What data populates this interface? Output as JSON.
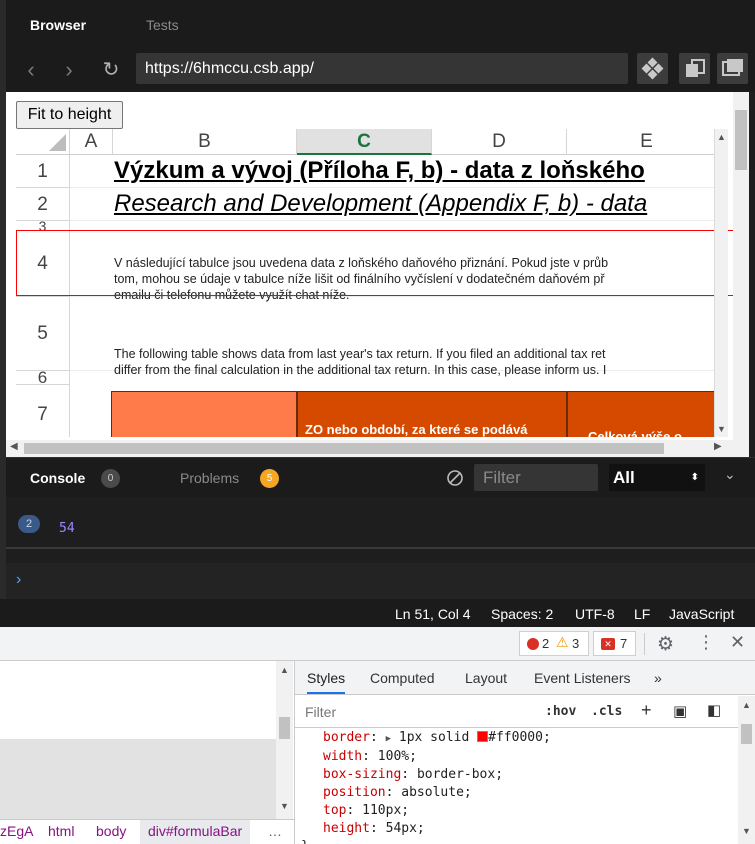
{
  "browser": {
    "tabs": {
      "browser": "Browser",
      "tests": "Tests"
    },
    "url": "https://6hmccu.csb.app/",
    "fit_button": "Fit to height"
  },
  "sheet": {
    "columns": [
      "A",
      "B",
      "C",
      "D",
      "E"
    ],
    "selected_column": "C",
    "rows": [
      "1",
      "2",
      "3",
      "4",
      "5",
      "6",
      "7"
    ],
    "title_cz": "Výzkum a vývoj (Příloha F, b) - data z loňského",
    "title_en": "Research and Development (Appendix F, b) - data",
    "row4_lines": [
      "V následující tabulce jsou uvedena data z loňského daňového přiznání. Pokud jste v průb",
      "tom, mohou se údaje v tabulce níže lišit od finálního vyčíslení v dodatečném daňovém př",
      "emailu či telefonu můžete využít chat níže."
    ],
    "row5_lines": [
      "The following table shows data from last year's tax return. If you filed an additional tax ret",
      "differ from the final calculation in the additional tax return. In this case, please inform us. I"
    ],
    "header_c2": "ZO nebo období, za které se podává",
    "header_c3": "Celková výše o"
  },
  "console": {
    "tab_console": "Console",
    "console_count": "0",
    "tab_problems": "Problems",
    "problems_count": "5",
    "filter_placeholder": "Filter",
    "level": "All",
    "log_repeat": "2",
    "log_value": "54",
    "prompt": "›"
  },
  "status": {
    "position": "Ln 51, Col 4",
    "spaces": "Spaces: 2",
    "encoding": "UTF-8",
    "eol": "LF",
    "language": "JavaScript"
  },
  "devtools": {
    "errors": "2",
    "warnings": "3",
    "issues": "7",
    "breadcrumbs": [
      "zEgA",
      "html",
      "body",
      "div#formulaBar",
      "…"
    ],
    "tabs": [
      "Styles",
      "Computed",
      "Layout",
      "Event Listeners",
      "»"
    ],
    "filter_placeholder": "Filter",
    "hov": ":hov",
    "cls": ".cls",
    "css": [
      {
        "prop": "border",
        "val": "1px solid",
        "color": "#ff0000"
      },
      {
        "prop": "width",
        "val": "100%;"
      },
      {
        "prop": "box-sizing",
        "val": "border-box;"
      },
      {
        "prop": "position",
        "val": "absolute;"
      },
      {
        "prop": "top",
        "val": "110px;"
      },
      {
        "prop": "height",
        "val": "54px;"
      }
    ],
    "css_border_color_text": "#ff0000;",
    "closing_brace": "}"
  },
  "colors": {
    "accent_orange": "#d64a00",
    "light_orange": "#ff7b4a",
    "selected_col": "#1a7440",
    "outline_red": "#ff0000"
  }
}
